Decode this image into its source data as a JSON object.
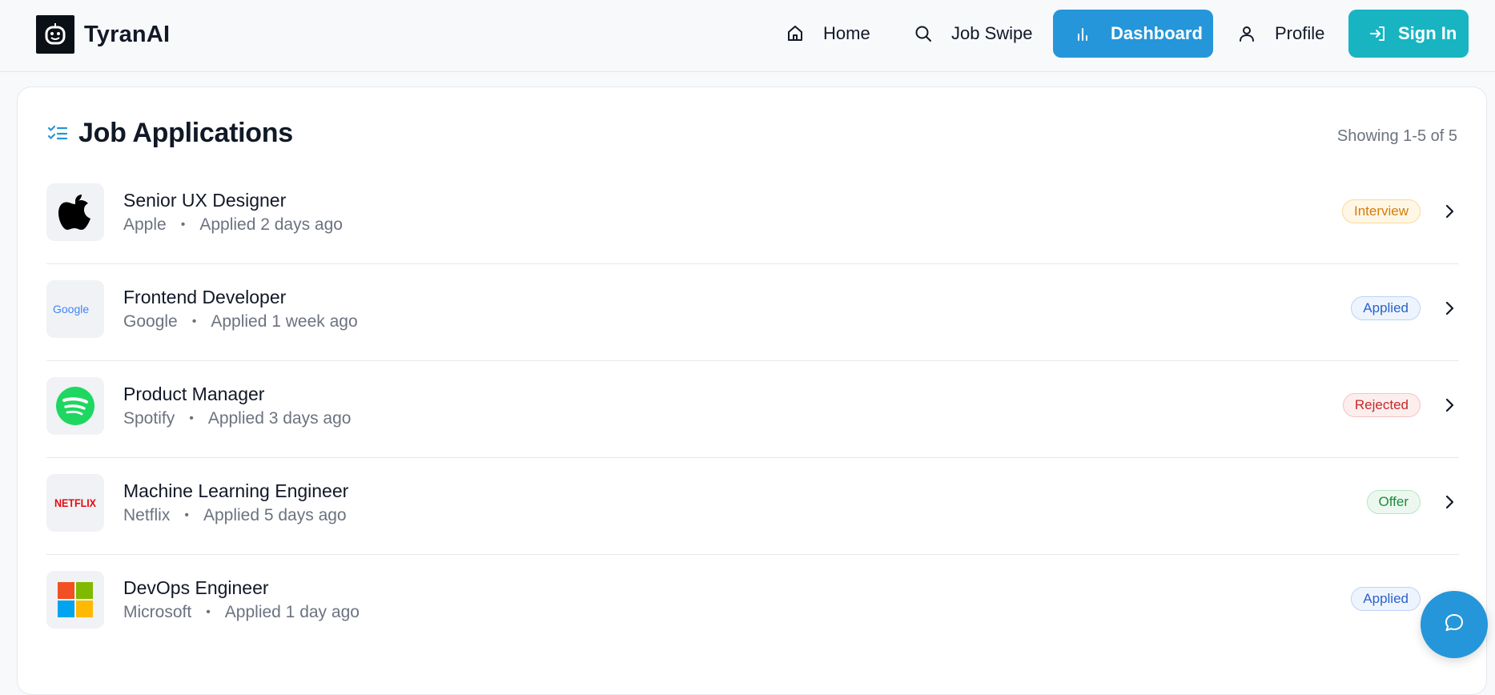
{
  "brand": {
    "name": "TyranAI",
    "logo_icon": "robot-face-icon"
  },
  "nav": {
    "home": "Home",
    "job_swipe": "Job Swipe",
    "dashboard": "Dashboard",
    "profile": "Profile",
    "sign_in": "Sign In",
    "active": "dashboard",
    "colors": {
      "dashboard_bg": "#2596d9",
      "signin_bg": "#18b4c2"
    }
  },
  "section": {
    "title": "Job Applications",
    "icon": "checklist-icon",
    "showing": "Showing 1-5 of 5"
  },
  "applications": [
    {
      "title": "Senior UX Designer",
      "company": "Apple",
      "applied": "Applied 2 days ago",
      "status": "Interview",
      "logo": "apple-logo",
      "badge_colors": {
        "bg": "#fff7e6",
        "border": "#fbd99a",
        "text": "#d47b0a"
      }
    },
    {
      "title": "Frontend Developer",
      "company": "Google",
      "applied": "Applied 1 week ago",
      "status": "Applied",
      "logo": "google-logo",
      "badge_colors": {
        "bg": "#eef4fd",
        "border": "#bcd3f5",
        "text": "#2a62c9"
      }
    },
    {
      "title": "Product Manager",
      "company": "Spotify",
      "applied": "Applied 3 days ago",
      "status": "Rejected",
      "logo": "spotify-logo",
      "badge_colors": {
        "bg": "#fdeeee",
        "border": "#f5c2c2",
        "text": "#c62828"
      }
    },
    {
      "title": "Machine Learning Engineer",
      "company": "Netflix",
      "applied": "Applied 5 days ago",
      "status": "Offer",
      "logo": "netflix-logo",
      "badge_colors": {
        "bg": "#ecf8ef",
        "border": "#b9e4c4",
        "text": "#1f8a3e"
      }
    },
    {
      "title": "DevOps Engineer",
      "company": "Microsoft",
      "applied": "Applied 1 day ago",
      "status": "Applied",
      "logo": "microsoft-logo",
      "badge_colors": {
        "bg": "#eef4fd",
        "border": "#bcd3f5",
        "text": "#2a62c9"
      }
    }
  ],
  "logo_text": {
    "google": "Google",
    "netflix": "NETFLIX"
  },
  "chat_fab": {
    "icon": "chat-bubble-icon"
  }
}
